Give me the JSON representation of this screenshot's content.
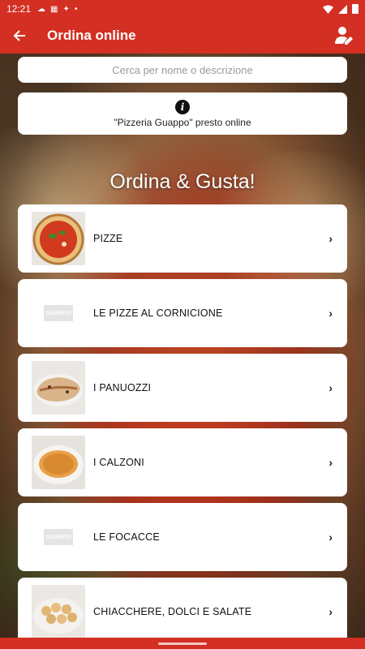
{
  "status_bar": {
    "time": "12:21",
    "icons": [
      "cloud-icon",
      "calendar-icon",
      "settings-icon",
      "dot-icon"
    ],
    "right_icons": [
      "wifi-icon",
      "signal-icon",
      "battery-icon"
    ]
  },
  "app_bar": {
    "title": "Ordina online",
    "back_icon": "arrow-left-icon",
    "account_icon": "account-edit-icon"
  },
  "search": {
    "placeholder": "Cerca per nome o descrizione"
  },
  "info": {
    "icon": "info-icon",
    "text": "\"Pizzeria Guappo\" presto online"
  },
  "headline": "Ordina & Gusta!",
  "categories": [
    {
      "label": "PIZZE",
      "thumb": "pizza-photo"
    },
    {
      "label": "LE PIZZE AL CORNICIONE",
      "thumb": "guappo-logo",
      "logo_text": "GUAPPO"
    },
    {
      "label": "I PANUOZZI",
      "thumb": "panuozzo-photo"
    },
    {
      "label": "I CALZONI",
      "thumb": "calzone-photo"
    },
    {
      "label": "LE FOCACCE",
      "thumb": "guappo-logo",
      "logo_text": "GUAPPO"
    },
    {
      "label": "CHIACCHERE, DOLCI E SALATE",
      "thumb": "dough-balls-photo"
    }
  ],
  "chevron": "›",
  "colors": {
    "brand_red": "#d32f22",
    "card": "#ffffff"
  }
}
